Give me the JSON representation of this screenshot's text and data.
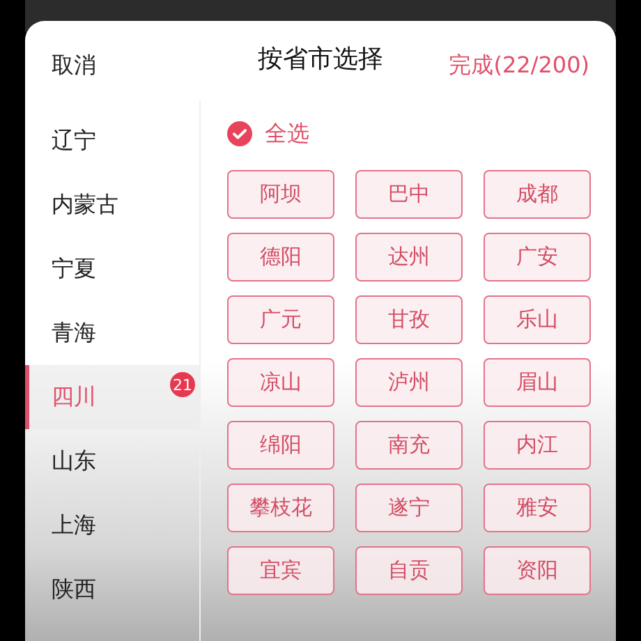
{
  "header": {
    "cancel": "取消",
    "title": "按省市选择",
    "done": "完成(22/200)"
  },
  "provinces": [
    {
      "name": "辽宁",
      "selected": false
    },
    {
      "name": "内蒙古",
      "selected": false
    },
    {
      "name": "宁夏",
      "selected": false
    },
    {
      "name": "青海",
      "selected": false
    },
    {
      "name": "四川",
      "selected": true,
      "badge": "21"
    },
    {
      "name": "山东",
      "selected": false
    },
    {
      "name": "上海",
      "selected": false
    },
    {
      "name": "陕西",
      "selected": false
    }
  ],
  "select_all": {
    "label": "全选",
    "checked": true
  },
  "cities": [
    {
      "name": "阿坝",
      "selected": true
    },
    {
      "name": "巴中",
      "selected": true
    },
    {
      "name": "成都",
      "selected": true
    },
    {
      "name": "德阳",
      "selected": true
    },
    {
      "name": "达州",
      "selected": true
    },
    {
      "name": "广安",
      "selected": true
    },
    {
      "name": "广元",
      "selected": true
    },
    {
      "name": "甘孜",
      "selected": true
    },
    {
      "name": "乐山",
      "selected": true
    },
    {
      "name": "凉山",
      "selected": true
    },
    {
      "name": "泸州",
      "selected": true
    },
    {
      "name": "眉山",
      "selected": true
    },
    {
      "name": "绵阳",
      "selected": true
    },
    {
      "name": "南充",
      "selected": true
    },
    {
      "name": "内江",
      "selected": true
    },
    {
      "name": "攀枝花",
      "selected": true
    },
    {
      "name": "遂宁",
      "selected": true
    },
    {
      "name": "雅安",
      "selected": true
    },
    {
      "name": "宜宾",
      "selected": true
    },
    {
      "name": "自贡",
      "selected": true
    },
    {
      "name": "资阳",
      "selected": true
    }
  ]
}
